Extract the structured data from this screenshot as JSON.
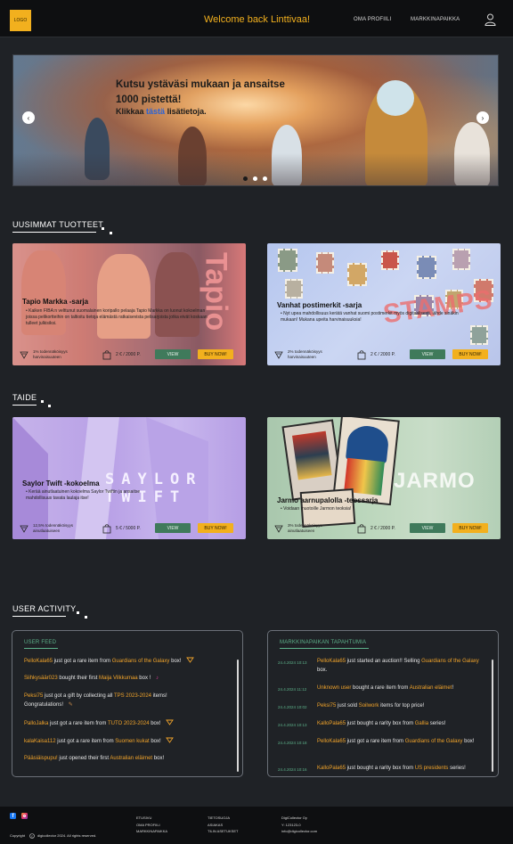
{
  "header": {
    "logo": "LOGO",
    "welcome": "Welcome back Linttivaa!",
    "nav": [
      "OMA PROFIILI",
      "MARKKINAPAIKKA"
    ]
  },
  "hero": {
    "title": "Kutsu ystäväsi mukaan ja ansaitse 1000 pistettä!",
    "sub_before": "Klikkaa",
    "sub_link": "tästä",
    "sub_after": "lisätietoja.",
    "prev": "‹",
    "next": "›",
    "slides": 3,
    "active_slide": 0
  },
  "sections": {
    "newest": "UUSIMMAT TUOTTEET",
    "art": "TAIDE",
    "activity": "USER ACTIVITY"
  },
  "cards": [
    {
      "title": "Tapio Markka -sarja",
      "desc": "Kaiken FIBA:n velttunut suomalainen koripallo pelaaja Tapio Markka on luonut kokoelman joissa pelikortteihin on taltioitu tietoja elämästä ratkaisevista pelisarjoista jotka eivät koskaan tulleet julkisiksi.",
      "rarity": "1% todennäköisyys harvinaisuuteen",
      "price": "2 € / 2000 P.",
      "view": "VIEW",
      "buy": "BUY NOW!",
      "overlay": "Tapio"
    },
    {
      "title": "Vanhat postimerkit -sarja",
      "desc": "Nyt upea mahdollisuus kerätä vanhat suomi postimerkit myös digitaalisesti, lähde sinäkin mukaan! Mukana upeita harvinaisuuksia!",
      "rarity": "2% todennäköisyys harvinaisuuteen",
      "price": "2 € / 2000 P.",
      "view": "VIEW",
      "buy": "BUY NOW!",
      "overlay": "STAMPS"
    },
    {
      "title": "Saylor Twift -kokoelma",
      "desc": "Kerää ainutlaatuinen kokoelma Saylor Twiftin ja ansaitse mahdollisuus tavata laulaja itse!",
      "rarity": "12,5% todennäköisyys ainutlaatuiseen",
      "price": "5 € / 5000 P.",
      "view": "VIEW",
      "buy": "BUY NOW!",
      "overlay": "SAYLOR TWIFT"
    },
    {
      "title": "Jarmo aarnupalolla -teossarja",
      "desc": "Voidaan muotoille Jarmon teoksia!",
      "rarity": "3% todennäköisyys ainutlaatuiseen",
      "price": "2 € / 2000 P.",
      "view": "VIEW",
      "buy": "BUY NOW!",
      "overlay": "JARMO"
    }
  ],
  "feed": {
    "title": "USER FEED",
    "items": [
      {
        "user": "PelloKala65",
        "text": " just got a rare item from ",
        "item": "Guardians of the Galaxy",
        "end": " box!"
      },
      {
        "user": "Siihkysäär023",
        "text": " bought their first ",
        "item": "Maija Vilkkumaa",
        "end": " box !"
      },
      {
        "user": "Peksi75",
        "text": " just got a gift by collecting all ",
        "item": "TPS 2023-2024",
        "end": " items! Gongratulations!"
      },
      {
        "user": "PalloJalka",
        "text": " just got a rare item from ",
        "item": "TUTO 2023-2024",
        "end": " box!"
      },
      {
        "user": "kalaKaisa112",
        "text": " just got a rare item from ",
        "item": "Suomen kukat",
        "end": " box!"
      },
      {
        "user": "Pääsiäispupu!",
        "text": " just opened their first ",
        "item": "Australian eläimet",
        "end": " box!"
      }
    ]
  },
  "market": {
    "title": "MARKKINAPAIKAN TAPAHTUMIA",
    "items": [
      {
        "time": "24.4.2024 10:13",
        "user": "PelloKala65",
        "text": " just started an auction!! Selling ",
        "item": "Guardians of the Galaxy",
        "end": " box."
      },
      {
        "time": "24.4.2024 11:12",
        "user": "Unknown user",
        "text": " bought a rare item from ",
        "item": "Australian eläimet",
        "end": "!"
      },
      {
        "time": "24.4.2024 10:02",
        "user": "Peksi75",
        "text": " just sold ",
        "item": "Soilwork",
        "end": " items for top price!"
      },
      {
        "time": "24.4.2024 10:13",
        "user": "KalloPala65",
        "text": " just bought a rarity box from ",
        "item": "Gallia",
        "end": " series!"
      },
      {
        "time": "24.4.2024 10:18",
        "user": "PelloKala65",
        "text": " just got a rare item from ",
        "item": "Guardians of the Galaxy",
        "end": " box!"
      },
      {
        "time": "24.4.2024 10:16",
        "user": "KalloPala65",
        "text": " just bought a rarity box from ",
        "item": "US presidents",
        "end": " series!"
      }
    ]
  },
  "footer": {
    "copyright": "Copyright",
    "rights": "digicollector 2024. All rights reserved.",
    "links1": [
      "ETUSIVU",
      "OMA PROFIILI",
      "MARKKINAPAIKKA"
    ],
    "links2": [
      "TIETOSUOJA",
      "ASIAKAS",
      "TILIN ASETUKSET"
    ],
    "contact": [
      "DigiCollector Oy",
      "Y: 123123-0",
      "info@digicollector.com"
    ]
  },
  "colors": {
    "accent": "#f2b01e",
    "green": "#5db28a",
    "highlight": "#f2a42a"
  }
}
